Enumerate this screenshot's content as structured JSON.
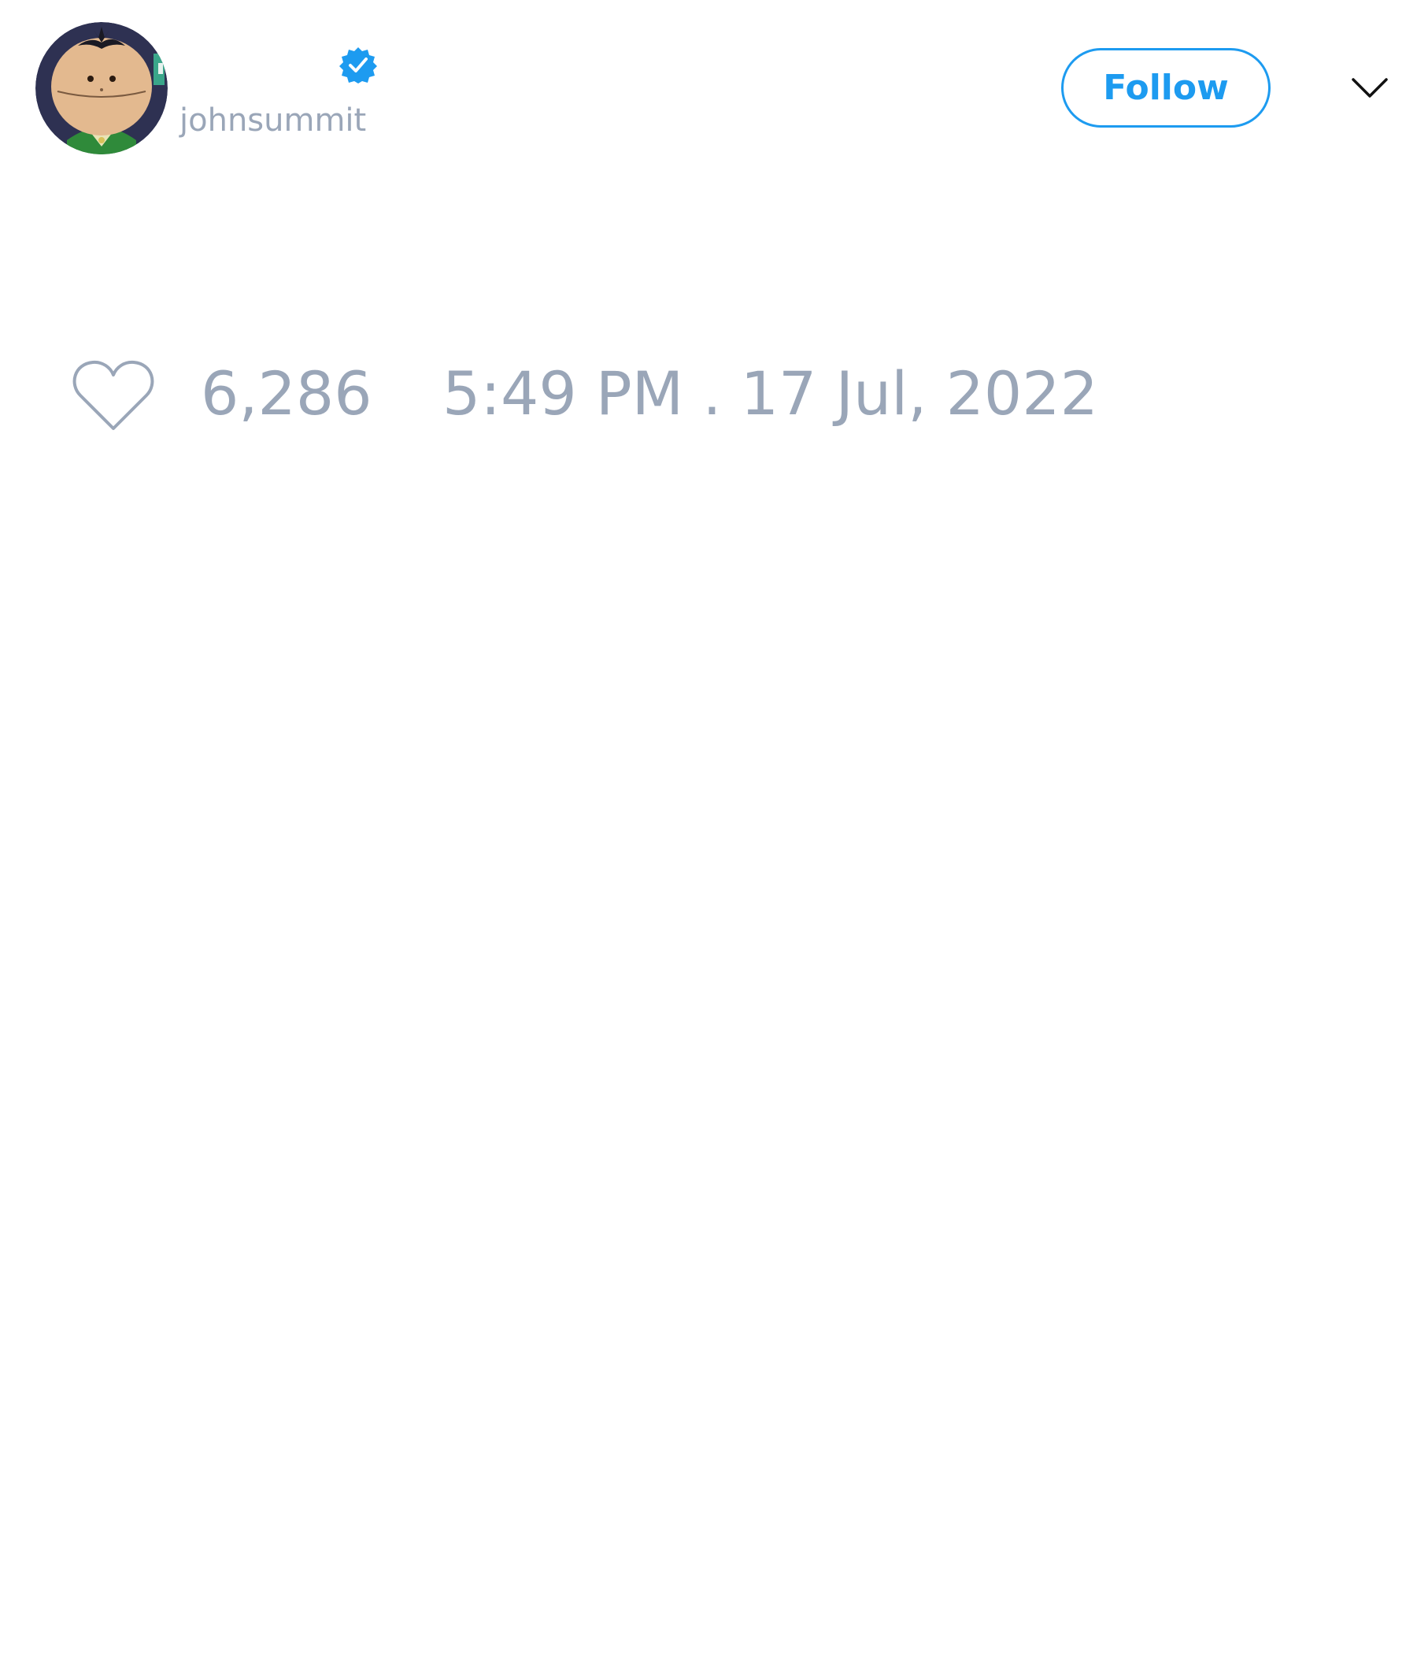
{
  "tweet": {
    "author": {
      "handle": "johnsummit",
      "verified": true,
      "avatar_icon": "cartoon-avatar",
      "verified_icon": "verified-badge-icon"
    },
    "follow_label": "Follow",
    "menu_icon": "chevron-down-icon",
    "like_icon": "heart-outline-icon",
    "like_count": "6,286",
    "timestamp": "5:49 PM . 17 Jul, 2022"
  },
  "colors": {
    "accent": "#1d9bf0",
    "muted_text": "#9aa6b8",
    "background": "#ffffff",
    "icon_stroke": "#9aa6b8",
    "chevron_stroke": "#111111"
  }
}
